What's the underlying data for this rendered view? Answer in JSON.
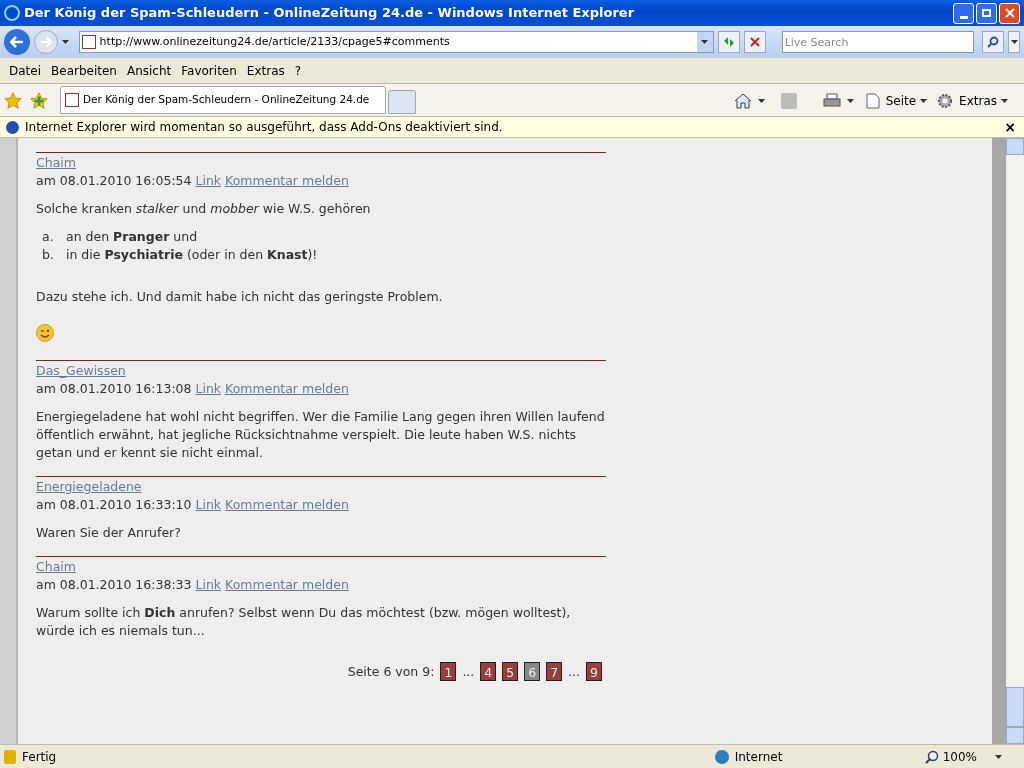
{
  "window": {
    "title": "Der König der Spam-Schleudern - OnlineZeitung 24.de - Windows Internet Explorer"
  },
  "address_bar": {
    "url": "http://www.onlinezeitung24.de/article/2133/cpage5#comments"
  },
  "search": {
    "placeholder": "Live Search"
  },
  "menu": [
    "Datei",
    "Bearbeiten",
    "Ansicht",
    "Favoriten",
    "Extras",
    "?"
  ],
  "tabs": [
    {
      "label": "Der König der Spam-Schleudern - OnlineZeitung 24.de",
      "selected": true
    }
  ],
  "command_bar": [
    "Seite",
    "Extras"
  ],
  "info_bar": {
    "text": "Internet Explorer wird momentan so ausgeführt, dass Add-Ons deaktiviert sind.",
    "close": "×"
  },
  "comments": [
    {
      "author": "Chaim",
      "date": "am 08.01.2010 16:05:54",
      "links": [
        "Link",
        "Kommentar melden"
      ],
      "body": [
        {
          "kind": "paragraph",
          "text": "Solche kranken *stalker* und *mobber* wie W.S. gehören"
        },
        {
          "kind": "list",
          "items": [
            {
              "marker": "a.",
              "text": "an den **Pranger** und"
            },
            {
              "marker": "b.",
              "text": "in die **Psychiatrie** (oder in den **Knast**)!"
            }
          ]
        },
        {
          "kind": "paragraph",
          "text": "Dazu stehe ich. Und damit habe ich nicht das geringste Problem."
        },
        {
          "kind": "smiley"
        }
      ]
    },
    {
      "author": "Das_Gewissen",
      "date": "am 08.01.2010 16:13:08",
      "links": [
        "Link",
        "Kommentar melden"
      ],
      "body": [
        {
          "kind": "paragraph",
          "text": "Energiegeladene hat wohl nicht begriffen. Wer die Familie Lang gegen ihren Willen laufend öffentlich erwähnt, hat jegliche Rücksichtnahme verspielt. Die leute haben W.S. nichts getan und er kennt sie nicht einmal."
        }
      ]
    },
    {
      "author": "Energiegeladene",
      "date": "am 08.01.2010 16:33:10",
      "links": [
        "Link",
        "Kommentar melden"
      ],
      "body": [
        {
          "kind": "paragraph",
          "text": "Waren Sie der Anrufer?"
        }
      ]
    },
    {
      "author": "Chaim",
      "date": "am 08.01.2010 16:38:33",
      "links": [
        "Link",
        "Kommentar melden"
      ],
      "body": [
        {
          "kind": "paragraph",
          "text": "Warum sollte ich **Dich** anrufen? Selbst wenn Du das möchtest (bzw. mögen wolltest), würde ich es niemals tun..."
        }
      ]
    }
  ],
  "pagination": {
    "label": "Seite 6 von 9:",
    "pages": [
      {
        "kind": "page",
        "label": "1",
        "selected": false
      },
      {
        "kind": "ellipsis",
        "label": "..."
      },
      {
        "kind": "page",
        "label": "4",
        "selected": false
      },
      {
        "kind": "page",
        "label": "5",
        "selected": false
      },
      {
        "kind": "page",
        "label": "6",
        "selected": true
      },
      {
        "kind": "page",
        "label": "7",
        "selected": false
      },
      {
        "kind": "ellipsis",
        "label": "..."
      },
      {
        "kind": "page",
        "label": "9",
        "selected": false
      }
    ]
  },
  "status_bar": {
    "status": "Fertig",
    "zone": "Internet",
    "zoom": "100%"
  }
}
